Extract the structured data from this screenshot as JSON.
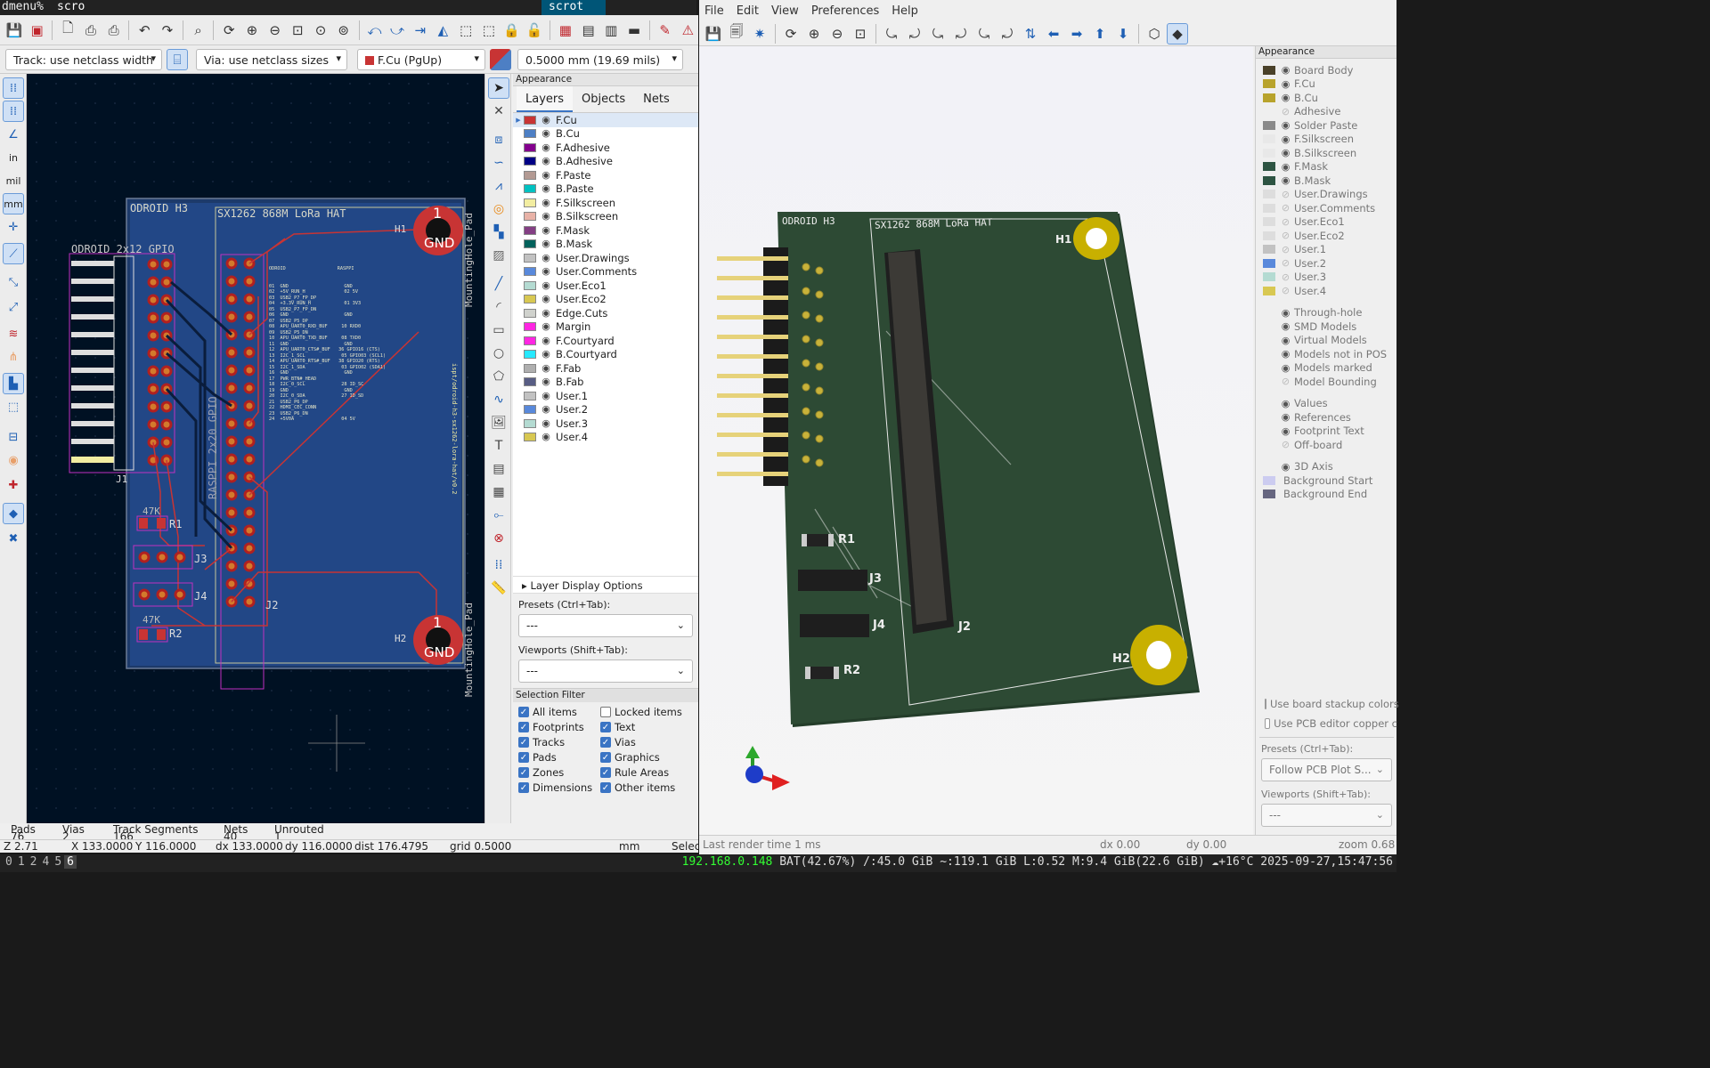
{
  "dmenu": {
    "prompt": "dmenu%",
    "input": "scro",
    "selected": "scrot"
  },
  "kicad": {
    "toolbar2": {
      "track_width": "Track: use netclass width",
      "via_size": "Via: use netclass sizes",
      "layer": "F.Cu (PgUp)",
      "grid": "0.5000 mm (19.69 mils)"
    },
    "left_toolbar": {
      "in": "in",
      "mil": "mil",
      "mm": "mm"
    },
    "board": {
      "title_odroid": "ODROID H3",
      "title_hat": "SX1262 868M LoRa HAT",
      "gpio_label": "ODROID 2x12 GPIO",
      "raspi_label": "RASPPI 2x20 GPIO",
      "mh_label": "MountingHole_Pad",
      "vertical_text": "ispt/odroid-h3-sx1262-lora-hat/v0.2",
      "h1": "H1",
      "h2": "H2",
      "gnd": "GND",
      "pad_num": "1",
      "j1": "J1",
      "j2": "J2",
      "j3": "J3",
      "j4": "J4",
      "r1": "R1",
      "r2": "R2",
      "r_val": "47K",
      "pin_table_header": [
        "ODROID",
        "RASPPI"
      ],
      "pin_table": [
        "01  GND                    GND",
        "02  +5V_RUN_H              02 5V",
        "03  USB2_P7_FP_DP",
        "04  +3.3V_RUN_H            01 3V3",
        "05  USB2_P7_FP_DN",
        "06  GND                    GND",
        "07  USB2_P5_DP",
        "08  APU_UART0_RXD_BUF     10 RXD0",
        "09  USB2_P5_DN",
        "10  APU_UART0_TXD_BUF     08 TXD0",
        "11  GND                    GND",
        "12  APU_UART0_CTS#_BUF   36 GPIO16 (CTS)",
        "13  I2C_1_SCL             05 GPIO03 (SCL1)",
        "14  APU_UART0_RTS#_BUF   38 GPIO20 (RTS)",
        "15  I2C_1_SDA             03 GPIO02 (SDA1)",
        "16  GND                    GND",
        "17  PWR_BTN#_HEAD",
        "18  I2C_0_SCL             28 ID_SC",
        "19  GND                    GND",
        "20  I2C_0_SDA             27 ID_SD",
        "21  USB2_P6_DP",
        "22  HDMI_CEC_CONN",
        "23  USB2_P6_DN",
        "24  +5V0A                 04 5V"
      ]
    },
    "appearance": {
      "title": "Appearance",
      "tabs": [
        "Layers",
        "Objects",
        "Nets"
      ],
      "layers": [
        {
          "name": "F.Cu",
          "color": "#c83434"
        },
        {
          "name": "B.Cu",
          "color": "#4d7fc4"
        },
        {
          "name": "F.Adhesive",
          "color": "#84008e"
        },
        {
          "name": "B.Adhesive",
          "color": "#000085"
        },
        {
          "name": "F.Paste",
          "color": "#b39a93"
        },
        {
          "name": "B.Paste",
          "color": "#00c2c2"
        },
        {
          "name": "F.Silkscreen",
          "color": "#f2eda1"
        },
        {
          "name": "B.Silkscreen",
          "color": "#e8b2a7"
        },
        {
          "name": "F.Mask",
          "color": "#843f84"
        },
        {
          "name": "B.Mask",
          "color": "#02625c"
        },
        {
          "name": "User.Drawings",
          "color": "#c2c2c2"
        },
        {
          "name": "User.Comments",
          "color": "#5989db"
        },
        {
          "name": "User.Eco1",
          "color": "#b4dbd2"
        },
        {
          "name": "User.Eco2",
          "color": "#d8c852"
        },
        {
          "name": "Edge.Cuts",
          "color": "#d0d2cd"
        },
        {
          "name": "Margin",
          "color": "#ff26e2"
        },
        {
          "name": "F.Courtyard",
          "color": "#ff26e2"
        },
        {
          "name": "B.Courtyard",
          "color": "#26e9ff"
        },
        {
          "name": "F.Fab",
          "color": "#afafaf"
        },
        {
          "name": "B.Fab",
          "color": "#585d84"
        },
        {
          "name": "User.1",
          "color": "#c2c2c2"
        },
        {
          "name": "User.2",
          "color": "#5989db"
        },
        {
          "name": "User.3",
          "color": "#b4dbd2"
        },
        {
          "name": "User.4",
          "color": "#d8c852"
        }
      ],
      "layer_display_options": "Layer Display Options",
      "presets_label": "Presets (Ctrl+Tab):",
      "presets_value": "---",
      "viewports_label": "Viewports (Shift+Tab):",
      "viewports_value": "---"
    },
    "selection_filter": {
      "title": "Selection Filter",
      "items": [
        {
          "label": "All items",
          "checked": true
        },
        {
          "label": "Locked items",
          "checked": false
        },
        {
          "label": "Footprints",
          "checked": true
        },
        {
          "label": "Text",
          "checked": true
        },
        {
          "label": "Tracks",
          "checked": true
        },
        {
          "label": "Vias",
          "checked": true
        },
        {
          "label": "Pads",
          "checked": true
        },
        {
          "label": "Graphics",
          "checked": true
        },
        {
          "label": "Zones",
          "checked": true
        },
        {
          "label": "Rule Areas",
          "checked": true
        },
        {
          "label": "Dimensions",
          "checked": true
        },
        {
          "label": "Other items",
          "checked": true
        }
      ]
    },
    "counts": {
      "headers": [
        "Pads",
        "Vias",
        "Track Segments",
        "Nets",
        "Unrouted"
      ],
      "values": [
        "76",
        "2",
        "166",
        "40",
        "1"
      ]
    },
    "status": {
      "z": "Z 2.71",
      "x": "X 133.0000",
      "y": "Y 116.0000",
      "dx": "dx 133.0000",
      "dy": "dy 116.0000",
      "dist": "dist 176.4795",
      "grid": "grid 0.5000",
      "units": "mm",
      "tool": "Selec"
    }
  },
  "viewer3d": {
    "menu": [
      "File",
      "Edit",
      "View",
      "Preferences",
      "Help"
    ],
    "appearance_title": "Appearance",
    "layers": [
      {
        "name": "Board Body",
        "color": "#4a4129",
        "visible": true
      },
      {
        "name": "F.Cu",
        "color": "#b8a32c",
        "visible": true
      },
      {
        "name": "B.Cu",
        "color": "#b8a32c",
        "visible": true
      },
      {
        "name": "Adhesive",
        "color": "",
        "visible": false
      },
      {
        "name": "Solder Paste",
        "color": "#8a8a8a",
        "visible": true
      },
      {
        "name": "F.Silkscreen",
        "color": "#e8e8e8",
        "visible": true
      },
      {
        "name": "B.Silkscreen",
        "color": "#e8e8e8",
        "visible": true
      },
      {
        "name": "F.Mask",
        "color": "#2d5442",
        "visible": true
      },
      {
        "name": "B.Mask",
        "color": "#2d5442",
        "visible": true
      },
      {
        "name": "User.Drawings",
        "color": "#dddddd",
        "visible": false
      },
      {
        "name": "User.Comments",
        "color": "#dddddd",
        "visible": false
      },
      {
        "name": "User.Eco1",
        "color": "#dddddd",
        "visible": false
      },
      {
        "name": "User.Eco2",
        "color": "#dddddd",
        "visible": false
      },
      {
        "name": "User.1",
        "color": "#c2c2c2",
        "visible": false
      },
      {
        "name": "User.2",
        "color": "#5989db",
        "visible": false
      },
      {
        "name": "User.3",
        "color": "#b4dbd2",
        "visible": false
      },
      {
        "name": "User.4",
        "color": "#d8c852",
        "visible": false
      }
    ],
    "model_opts": [
      {
        "name": "Through-hole",
        "visible": true
      },
      {
        "name": "SMD Models",
        "visible": true
      },
      {
        "name": "Virtual Models",
        "visible": true
      },
      {
        "name": "Models not in POS",
        "visible": true
      },
      {
        "name": "Models marked",
        "visible": true
      },
      {
        "name": "Model Bounding",
        "visible": false
      }
    ],
    "text_opts": [
      {
        "name": "Values",
        "visible": true
      },
      {
        "name": "References",
        "visible": true
      },
      {
        "name": "Footprint Text",
        "visible": true
      },
      {
        "name": "Off-board",
        "visible": false
      }
    ],
    "axis_label": "3D Axis",
    "bg_start": "Background Start",
    "bg_end": "Background End",
    "bg_start_color": "#ccccf0",
    "bg_end_color": "#666680",
    "use_stackup": "Use board stackup colors",
    "use_pcb_copper": "Use PCB editor copper c",
    "presets_label": "Presets (Ctrl+Tab):",
    "presets_value": "Follow PCB Plot S...",
    "viewports_label": "Viewports (Shift+Tab):",
    "viewports_value": "---",
    "status": {
      "render": "Last render time 1 ms",
      "dx": "dx 0.00",
      "dy": "dy 0.00",
      "zoom": "zoom 0.68"
    },
    "board": {
      "title_odroid": "ODROID H3",
      "title_hat": "SX1262 868M LoRa HAT",
      "h1": "H1",
      "h2": "H2",
      "j2": "J2",
      "j3": "J3",
      "j4": "J4",
      "r1": "R1",
      "r2": "R2"
    }
  },
  "bar": {
    "tags": [
      "0",
      "1",
      "2",
      "4",
      "5",
      "6"
    ],
    "active_tag": "6",
    "ip": "192.168.0.148",
    "bat": "BAT(42.67%)",
    "root": "/:45.0 GiB",
    "home": "~:119.1 GiB",
    "load": "L:0.52",
    "mem": "M:9.4 GiB(22.6 GiB)",
    "weather": "☁+16°C",
    "datetime": "2025-09-27,15:47:56"
  }
}
